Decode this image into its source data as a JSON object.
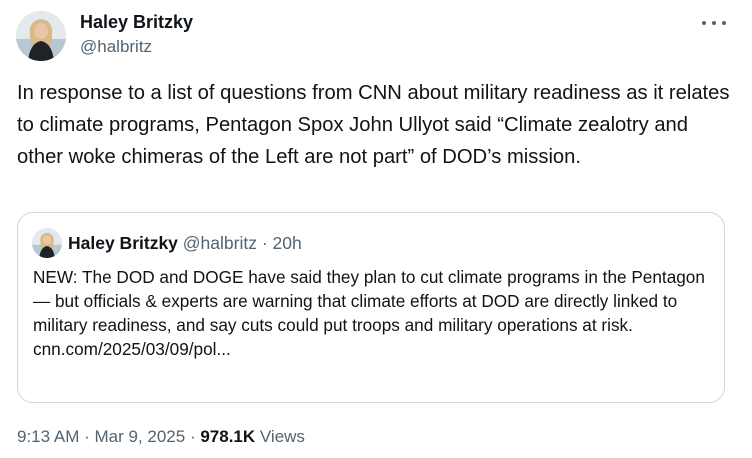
{
  "author": {
    "name": "Haley Britzky",
    "handle": "@halbritz"
  },
  "icons": {
    "more": "more-horizontal-icon"
  },
  "tweet": {
    "text": "In response to a list of questions from CNN about military readiness as it relates to climate programs, Pentagon Spox John Ullyot said “Climate zealotry and other woke chimeras of the Left are not part” of DOD’s mission."
  },
  "quote": {
    "name": "Haley Britzky",
    "handle": "@halbritz",
    "separator": " · ",
    "time": "20h",
    "text": "NEW: The DOD and DOGE have said they plan to cut climate programs in the Pentagon — but officials & experts are warning that climate efforts at DOD are directly linked to military readiness, and say cuts could put troops and military operations at risk.",
    "link": "cnn.com/2025/03/09/pol..."
  },
  "meta": {
    "time": "9:13 AM",
    "separator": " · ",
    "date": "Mar 9, 2025",
    "views_count": "978.1K",
    "views_label": " Views"
  },
  "colors": {
    "text_primary": "#0f1419",
    "text_secondary": "#536471",
    "border": "#cfd9de"
  }
}
